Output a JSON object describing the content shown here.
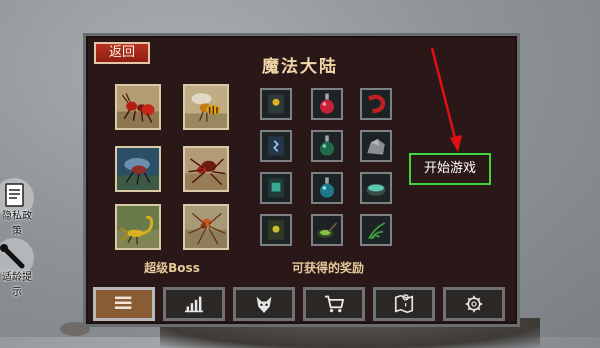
{
  "header": {
    "back_label": "返回",
    "title": "魔法大陆"
  },
  "enemies": {
    "label": "超级Boss",
    "items": [
      {
        "icon": "red-ant-icon"
      },
      {
        "icon": "wasp-icon"
      },
      {
        "icon": "blue-mosquito-icon"
      },
      {
        "icon": "red-spider-icon"
      },
      {
        "icon": "scorpion-icon"
      },
      {
        "icon": "orange-spider-icon"
      }
    ]
  },
  "rewards": {
    "label": "可获得的奖励",
    "items": [
      {
        "icon": "yellow-book-icon"
      },
      {
        "icon": "red-potion-icon"
      },
      {
        "icon": "red-shrimp-icon"
      },
      {
        "icon": "blue-book-icon"
      },
      {
        "icon": "green-potion-icon"
      },
      {
        "icon": "gray-stone-icon"
      },
      {
        "icon": "teal-book-icon"
      },
      {
        "icon": "teal-potion-icon"
      },
      {
        "icon": "teal-bowl-icon"
      },
      {
        "icon": "yellow-green-book-icon"
      },
      {
        "icon": "green-mortar-icon"
      },
      {
        "icon": "green-herb-icon"
      }
    ]
  },
  "start_game": {
    "label": "开始游戏",
    "accent": "#3ed53e"
  },
  "side": {
    "items": [
      {
        "label": "隐私政策"
      },
      {
        "label": "适龄提示"
      }
    ]
  },
  "bottom_nav": [
    {
      "icon": "menu-icon",
      "active": true
    },
    {
      "icon": "stats-icon"
    },
    {
      "icon": "wolf-icon"
    },
    {
      "icon": "cart-icon"
    },
    {
      "icon": "map-icon"
    },
    {
      "icon": "gear-icon"
    }
  ],
  "colors": {
    "panel": "#2a1718",
    "back_button": "#b8321f",
    "title": "#f1d6a8",
    "arrow": "#e01010"
  }
}
